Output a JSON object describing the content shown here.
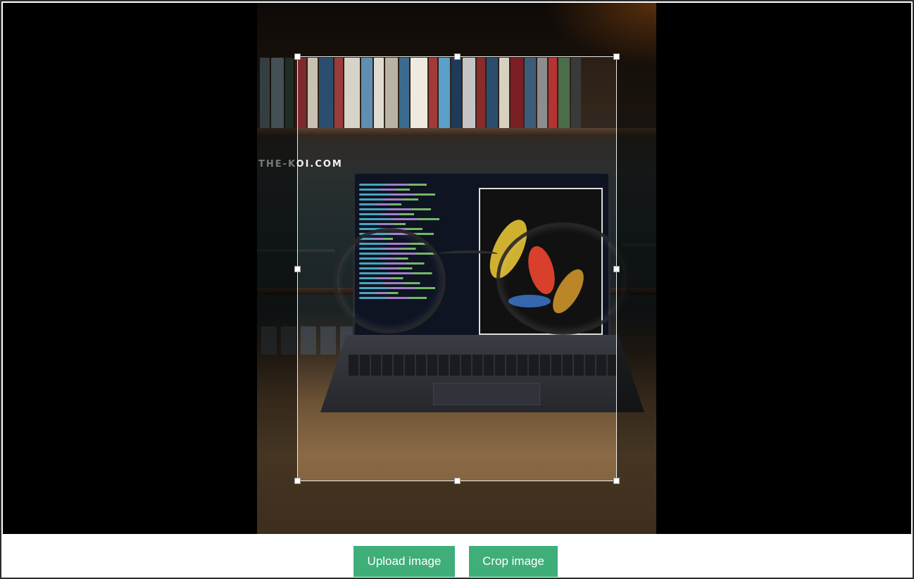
{
  "image": {
    "watermark": "THE-KOI.COM"
  },
  "crop": {
    "handle_icon": "square-handle"
  },
  "footer": {
    "upload_label": "Upload image",
    "crop_label": "Crop image"
  },
  "colors": {
    "button": "#3fae79",
    "stage_background": "#000000"
  }
}
